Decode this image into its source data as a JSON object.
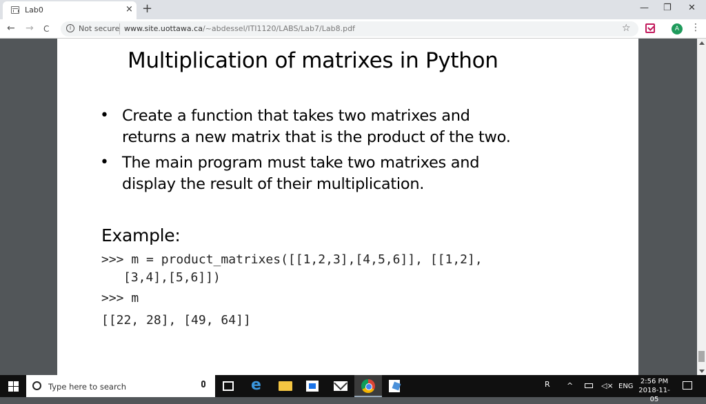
{
  "browser": {
    "tab_title": "Lab0",
    "tab_close": "×",
    "new_tab": "+",
    "window_controls": {
      "minimize": "—",
      "restore": "❐",
      "close": "✕"
    },
    "nav": {
      "back": "←",
      "forward": "→",
      "reload": "C"
    },
    "security_label": "Not secure",
    "url_domain": "www.site.uottawa.ca",
    "url_path": "/~abdessel/ITI1120/LABS/Lab7/Lab8.pdf",
    "profile_initial": "A",
    "menu": "⋮",
    "star": "☆"
  },
  "slide": {
    "title": "Multiplication of matrixes in Python",
    "bullets": [
      {
        "line1": " Create a function that takes two matrixes and",
        "line2": "returns a new matrix that is the product of the two."
      },
      {
        "line1": "The main program must take two matrixes and",
        "line2": "display the result of their multiplication."
      }
    ],
    "bullet_symbol": "•",
    "example_label": "Example:",
    "code_line1": ">>> m = product_matrixes([[1,2,3],[4,5,6]], [[1,2],",
    "code_line2": "[3,4],[5,6]])",
    "code_line3": ">>> m",
    "code_line4": "[[22, 28], [49, 64]]"
  },
  "taskbar": {
    "search_placeholder": "Type here to search",
    "tray_people": "R",
    "tray_up": "^",
    "tray_volume": "◁×",
    "language": "ENG",
    "time": "2:56 PM",
    "date": "2018-11-05"
  }
}
